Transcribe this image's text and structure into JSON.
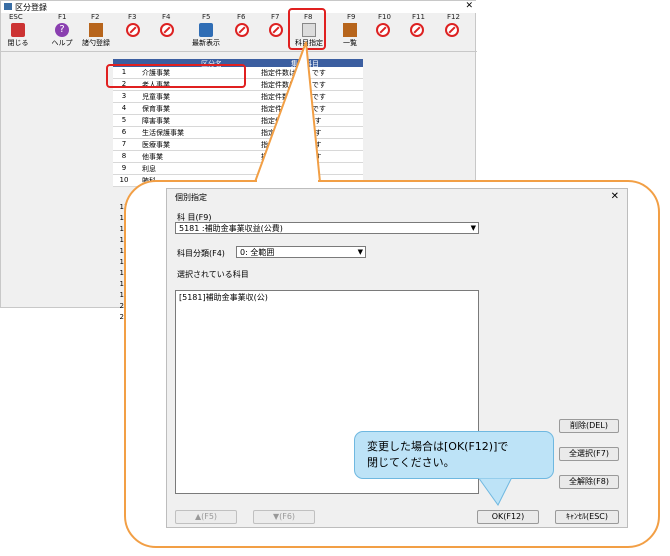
{
  "window": {
    "title": "区分登録"
  },
  "fkeys": [
    "ESC",
    "F1",
    "F2",
    "F3",
    "F4",
    "F5",
    "F6",
    "F7",
    "F8",
    "F9",
    "F10",
    "F11",
    "F12"
  ],
  "toolbar": {
    "close": "閉じる",
    "help": "ヘルプ",
    "bulk": "諸勺登録",
    "refresh": "最新表示",
    "subject": "科目指定",
    "list": "一覧"
  },
  "grid": {
    "header_kubun": "区分名",
    "header_count": "集計科目",
    "rows": [
      {
        "no": "1",
        "name": "介護事業",
        "count": "指定件数は  0件 です"
      },
      {
        "no": "2",
        "name": "老人事業",
        "count": "指定件数は  1件 です"
      },
      {
        "no": "3",
        "name": "児童事業",
        "count": "指定件数は  1件 です"
      },
      {
        "no": "4",
        "name": "保育事業",
        "count": "指定件数は  1件 です"
      },
      {
        "no": "5",
        "name": "障害事業",
        "count": "指定件数は  件 です"
      },
      {
        "no": "6",
        "name": "生活保護事業",
        "count": "指定件数は  件 です"
      },
      {
        "no": "7",
        "name": "医療事業",
        "count": "指定件数は  件 です"
      },
      {
        "no": "8",
        "name": "他事業",
        "count": "指定件数は  件 です"
      },
      {
        "no": "9",
        "name": "利息",
        "count": ""
      },
      {
        "no": "10",
        "name": "賄科",
        "count": ""
      }
    ],
    "more_numbers": [
      "11",
      "12",
      "13",
      "14",
      "15",
      "16",
      "17",
      "18",
      "19",
      "20",
      "21"
    ]
  },
  "dialog": {
    "title": "個別指定",
    "subject_label": "科 目(F9)",
    "subject_value": "5181       :補助金事業収益(公費)",
    "category_label": "科目分類(F4)",
    "category_value": "0: 全範囲",
    "selected_label": "選択されている科目",
    "selected_items": [
      "[5181]補助金事業収(公)"
    ],
    "delete_btn": "削除(DEL)",
    "select_all_btn": "全選択(F7)",
    "deselect_all_btn": "全解除(F8)",
    "up_btn": "▲(F5)",
    "down_btn": "▼(F6)",
    "ok_btn": "OK(F12)",
    "cancel_btn": "ｷｬﾝｾﾙ(ESC)"
  },
  "tooltip": {
    "line1": "変更した場合は[OK(F12)]で",
    "line2": "閉じてください。"
  },
  "colors": {
    "accent_red": "#e02020",
    "callout": "#f29f45",
    "tip_bg": "#bde3f7",
    "grid_header": "#3b5ea0"
  }
}
